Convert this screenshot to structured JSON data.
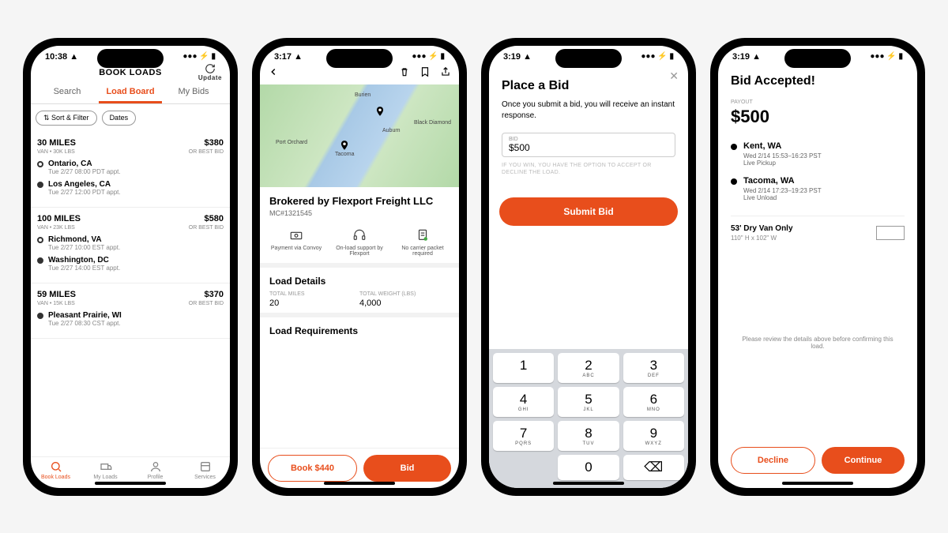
{
  "status_icons": "●●● ⚡ ▮",
  "phone1": {
    "time": "10:38 ▲",
    "title": "BOOK LOADS",
    "update": "Update",
    "tabs": [
      "Search",
      "Load Board",
      "My Bids"
    ],
    "active_tab": 1,
    "chips": [
      "⇅ Sort & Filter",
      "Dates"
    ],
    "loads": [
      {
        "miles": "30 MILES",
        "price": "$380",
        "meta_l": "VAN • 30K LBS",
        "meta_r": "OR BEST BID",
        "stops": [
          {
            "city": "Ontario, CA",
            "time": "Tue 2/27 08:00 PDT appt."
          },
          {
            "city": "Los Angeles, CA",
            "time": "Tue 2/27 12:00 PDT appt."
          }
        ]
      },
      {
        "miles": "100 MILES",
        "price": "$580",
        "meta_l": "VAN • 23K LBS",
        "meta_r": "OR BEST BID",
        "stops": [
          {
            "city": "Richmond, VA",
            "time": "Tue 2/27 10:00 EST appt."
          },
          {
            "city": "Washington, DC",
            "time": "Tue 2/27 14:00 EST appt."
          }
        ]
      },
      {
        "miles": "59 MILES",
        "price": "$370",
        "meta_l": "VAN • 15K LBS",
        "meta_r": "OR BEST BID",
        "stops": [
          {
            "city": "Pleasant Prairie, WI",
            "time": "Tue 2/27 08:30 CST appt."
          }
        ]
      }
    ],
    "nav": [
      "Book Loads",
      "My Loads",
      "Profile",
      "Services"
    ]
  },
  "phone2": {
    "time": "3:17 ▲",
    "broker": "Brokered by Flexport Freight LLC",
    "mc": "MC#1321545",
    "features": [
      "Payment via Convoy",
      "On-load support by Flexport",
      "No carrier packet required"
    ],
    "section1": "Load Details",
    "miles_l": "TOTAL MILES",
    "miles_v": "20",
    "weight_l": "TOTAL WEIGHT (LBS)",
    "weight_v": "4,000",
    "section2": "Load Requirements",
    "book": "Book $440",
    "bid": "Bid",
    "map_labels": [
      "Burien",
      "Tacoma",
      "Auburn",
      "Black Diamond",
      "Port Orchard"
    ]
  },
  "phone3": {
    "time": "3:19 ▲",
    "title": "Place a Bid",
    "desc": "Once you submit a bid, you will receive an instant response.",
    "field_l": "BID",
    "field_v": "$500",
    "hint": "IF YOU WIN, YOU HAVE THE OPTION TO ACCEPT OR DECLINE THE LOAD.",
    "submit": "Submit Bid",
    "keys": [
      [
        "1",
        ""
      ],
      [
        "2",
        "ABC"
      ],
      [
        "3",
        "DEF"
      ],
      [
        "4",
        "GHI"
      ],
      [
        "5",
        "JKL"
      ],
      [
        "6",
        "MNO"
      ],
      [
        "7",
        "PQRS"
      ],
      [
        "8",
        "TUV"
      ],
      [
        "9",
        "WXYZ"
      ],
      [
        "",
        ""
      ],
      [
        "0",
        ""
      ],
      [
        "⌫",
        ""
      ]
    ]
  },
  "phone4": {
    "time": "3:19 ▲",
    "title": "Bid Accepted!",
    "payout_l": "PAYOUT",
    "payout_v": "$500",
    "stops": [
      {
        "city": "Kent, WA",
        "time": "Wed 2/14 15:53–16:23 PST",
        "type": "Live Pickup"
      },
      {
        "city": "Tacoma, WA",
        "time": "Wed 2/14 17:23–19:23 PST",
        "type": "Live Unload"
      }
    ],
    "equip": "53' Dry Van Only",
    "equip_dim": "110\" H x 102\" W",
    "review": "Please review the details above before confirming this load.",
    "decline": "Decline",
    "continue": "Continue"
  }
}
